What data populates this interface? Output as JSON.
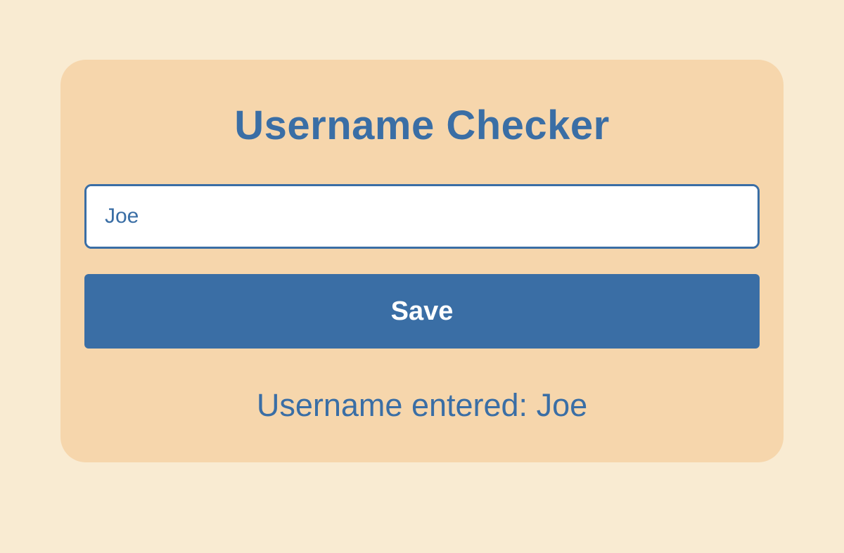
{
  "card": {
    "title": "Username Checker",
    "input_value": "Joe",
    "input_placeholder": "",
    "save_label": "Save",
    "result_text": "Username entered: Joe"
  }
}
